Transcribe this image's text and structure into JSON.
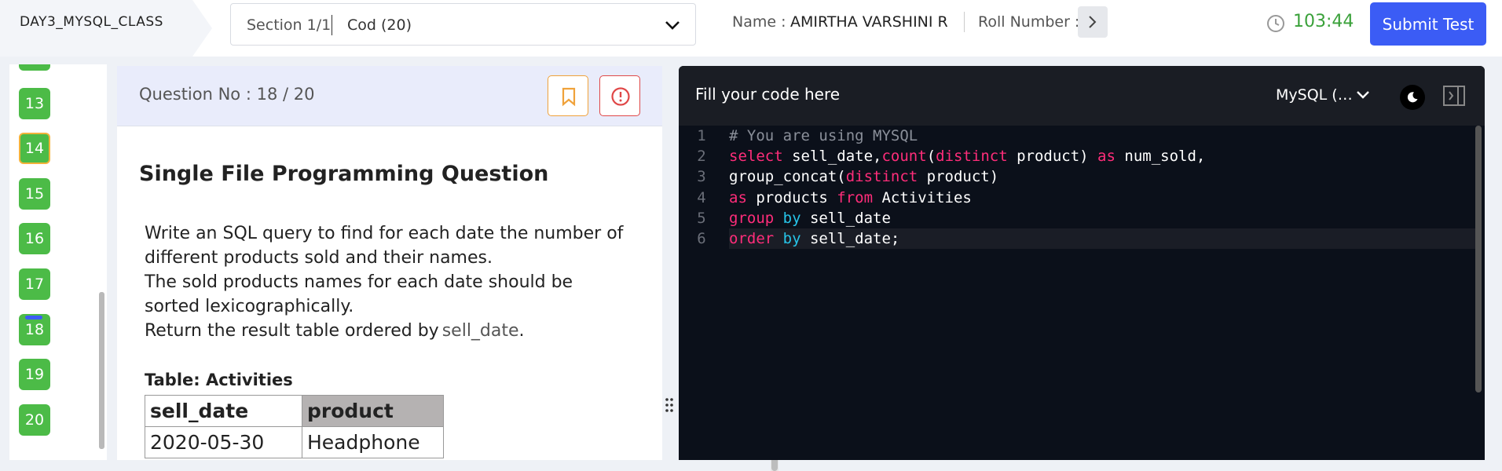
{
  "header": {
    "course_title": "DAY3_MYSQL_CLASS",
    "section": "Section 1/1",
    "section_value": "Cod (20)",
    "name_label": "Name :",
    "name_value": "AMIRTHA VARSHINI R",
    "roll_label": "Roll Number :",
    "timer": "103:44",
    "submit_label": "Submit Test"
  },
  "qnav": {
    "items": [
      {
        "number": "13",
        "state": "answered"
      },
      {
        "number": "14",
        "state": "answered-flagged"
      },
      {
        "number": "15",
        "state": "answered"
      },
      {
        "number": "16",
        "state": "answered"
      },
      {
        "number": "17",
        "state": "answered"
      },
      {
        "number": "18",
        "state": "current"
      },
      {
        "number": "19",
        "state": "answered"
      },
      {
        "number": "20",
        "state": "answered"
      }
    ]
  },
  "question": {
    "number_label": "Question No : 18 / 20",
    "type": "Single File Programming Question",
    "lines": [
      "Write an SQL query to find for each date the number of",
      "different products sold and their names.",
      "The sold products names for each date should be",
      "sorted lexicographically.",
      "Return the result table ordered by"
    ],
    "inline_code": "sell_date",
    "after_inline": ".",
    "table_caption": "Table: Activities",
    "table_headers": [
      "sell_date",
      "product"
    ],
    "table_rows": [
      [
        "2020-05-30",
        "Headphone"
      ]
    ]
  },
  "editor": {
    "title": "Fill your code here",
    "language": "MySQL (…",
    "line_numbers": [
      "1",
      "2",
      "3",
      "4",
      "5",
      "6"
    ]
  },
  "colors": {
    "accent": "#3b5cf5",
    "answered": "#4cbb47",
    "timer": "#3aa13a"
  }
}
